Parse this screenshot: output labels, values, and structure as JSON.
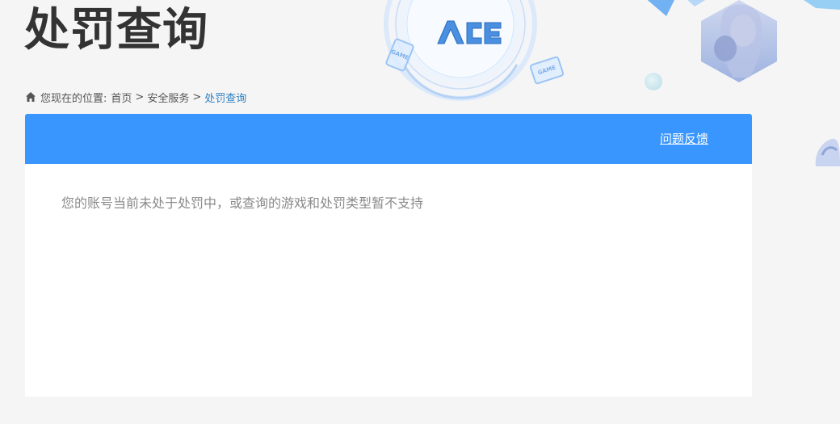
{
  "header": {
    "title": "处罚查询",
    "logo_text": "ACE",
    "tile_label": "GAME"
  },
  "breadcrumb": {
    "prefix": "您现在的位置:",
    "items": [
      "首页",
      "安全服务",
      "处罚查询"
    ],
    "separator": ">"
  },
  "panel": {
    "feedback_label": "问题反馈",
    "message": "您的账号当前未处于处罚中，或查询的游戏和处罚类型暂不支持"
  },
  "colors": {
    "accent": "#3896fe",
    "title": "#333333",
    "breadcrumb_current": "#2c7fbf",
    "message": "#8a8a8a",
    "background": "#f5f5f6"
  }
}
